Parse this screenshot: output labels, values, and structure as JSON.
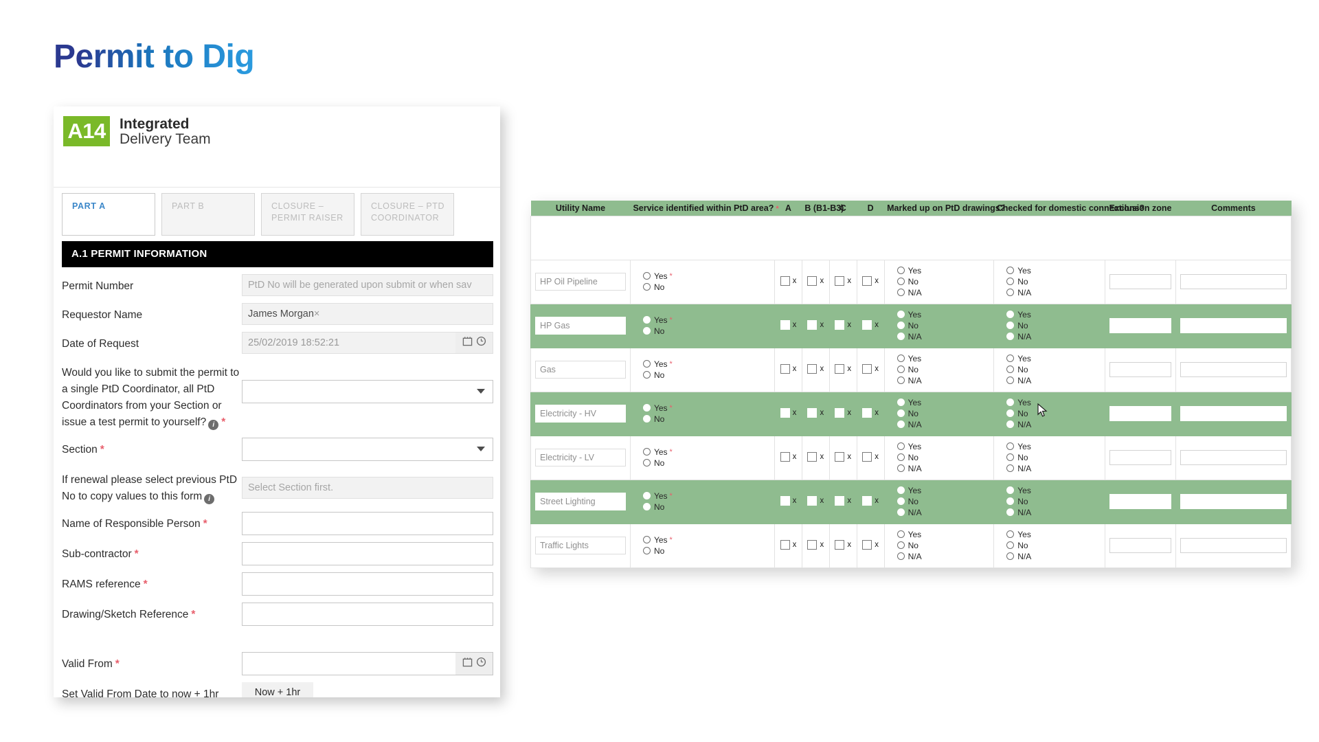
{
  "page": {
    "title": "Permit to Dig"
  },
  "brand": {
    "logo": "A14",
    "line1": "Integrated",
    "line2": "Delivery Team"
  },
  "tabs": [
    {
      "label": "PART A",
      "active": true
    },
    {
      "label": "PART B",
      "active": false
    },
    {
      "label": "CLOSURE – PERMIT RAISER",
      "active": false
    },
    {
      "label": "CLOSURE – PTD COORDINATOR",
      "active": false
    }
  ],
  "section": {
    "heading": "A.1 PERMIT INFORMATION"
  },
  "fields": {
    "permit_number": {
      "label": "Permit Number",
      "placeholder": "PtD No will be generated upon submit or when sav",
      "value": ""
    },
    "requestor_name": {
      "label": "Requestor Name",
      "value": "James Morgan",
      "remove_icon": "×"
    },
    "date_of_request": {
      "label": "Date of Request",
      "value": "25/02/2019 18:52:21"
    },
    "submit_to": {
      "label": "Would you like to submit the permit to a single PtD Coordinator, all PtD Coordinators from your Section or issue a test permit to yourself?",
      "value": "",
      "required": true,
      "has_info": true
    },
    "section_select": {
      "label": "Section",
      "value": "",
      "required": true
    },
    "previous_ptd": {
      "label": "If renewal please select previous PtD No to copy values to this form",
      "placeholder": "Select Section first.",
      "value": "",
      "has_info": true
    },
    "responsible_person": {
      "label": "Name of Responsible Person",
      "value": "",
      "required": true
    },
    "sub_contractor": {
      "label": "Sub-contractor",
      "value": "",
      "required": true
    },
    "rams_reference": {
      "label": "RAMS reference",
      "value": "",
      "required": true
    },
    "drawing_reference": {
      "label": "Drawing/Sketch Reference",
      "value": "",
      "required": true
    },
    "valid_from": {
      "label": "Valid From",
      "value": "",
      "required": true
    },
    "set_valid_from": {
      "label": "Set Valid From Date to now + 1hr",
      "button": "Now + 1hr"
    }
  },
  "icons": {
    "calendar": "calendar-icon",
    "clock": "clock-icon",
    "dropdown": "chevron-down-icon",
    "info": "info-icon",
    "clear": "clear-icon"
  },
  "colors": {
    "title_dark": "#2b3990",
    "title_light": "#2b9ce0",
    "brand_green": "#7ab929",
    "table_green": "#8fbc8f",
    "section_black": "#000000",
    "required_red": "#e8606d",
    "active_tab_blue": "#3b87c9"
  },
  "table": {
    "columns": [
      {
        "key": "utility",
        "label": "Utility Name"
      },
      {
        "key": "service",
        "label": "Service identified within PtD area?",
        "required": true
      },
      {
        "key": "a",
        "label": "A"
      },
      {
        "key": "b",
        "label": "B (B1-B3)"
      },
      {
        "key": "c",
        "label": "C"
      },
      {
        "key": "d",
        "label": "D"
      },
      {
        "key": "marked",
        "label": "Marked up on PtD drawings?"
      },
      {
        "key": "domestic",
        "label": "Checked for domestic connections?"
      },
      {
        "key": "exclusion",
        "label": "Exclusion zone"
      },
      {
        "key": "comments",
        "label": "Comments"
      }
    ],
    "service_options": [
      "Yes",
      "No"
    ],
    "triple_options": [
      "Yes",
      "No",
      "N/A"
    ],
    "checkbox_label": "x",
    "rows": [
      {
        "utility": "HP Oil Pipeline",
        "highlight": false,
        "exclusion": "",
        "comments": ""
      },
      {
        "utility": "HP Gas",
        "highlight": true,
        "exclusion": "",
        "comments": ""
      },
      {
        "utility": "Gas",
        "highlight": false,
        "exclusion": "",
        "comments": ""
      },
      {
        "utility": "Electricity - HV",
        "highlight": true,
        "exclusion": "",
        "comments": ""
      },
      {
        "utility": "Electricity - LV",
        "highlight": false,
        "exclusion": "",
        "comments": ""
      },
      {
        "utility": "Street Lighting",
        "highlight": true,
        "exclusion": "",
        "comments": ""
      },
      {
        "utility": "Traffic Lights",
        "highlight": false,
        "exclusion": "",
        "comments": ""
      }
    ]
  }
}
